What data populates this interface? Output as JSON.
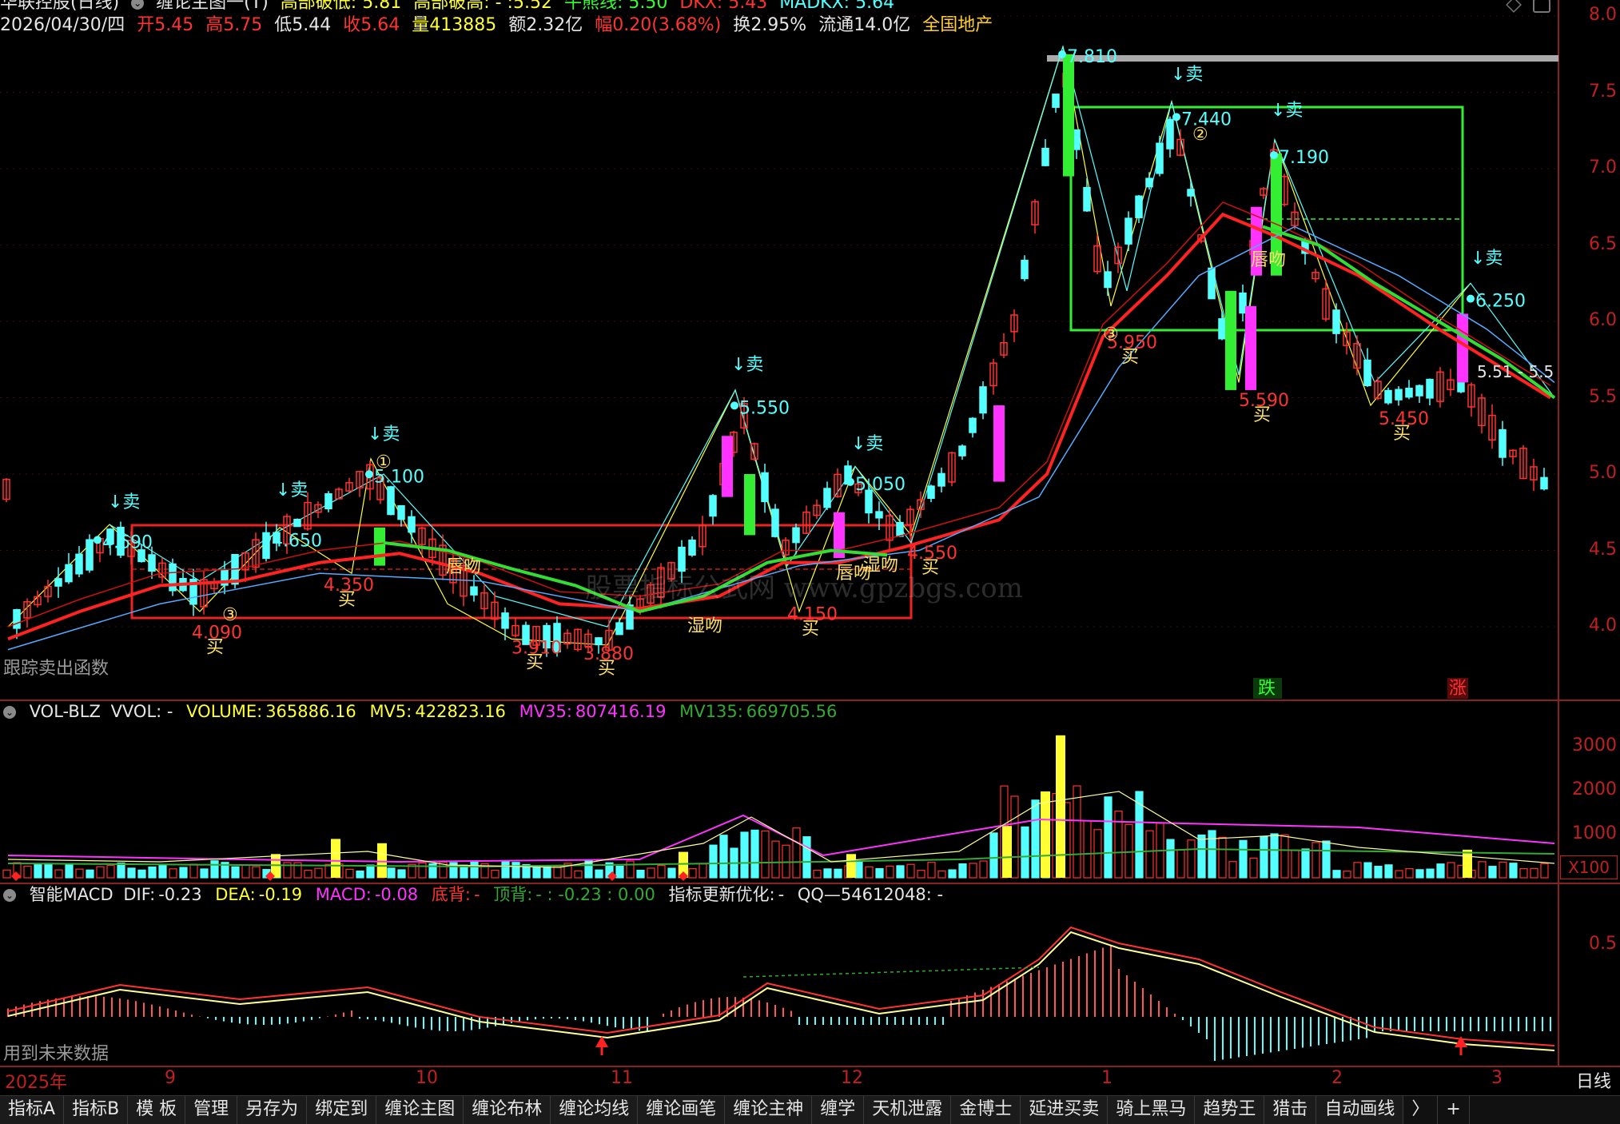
{
  "header": {
    "line1": {
      "stock": "华联控股(日线)",
      "indicator_main": "缠论主图一(T)",
      "ds_label": "高部破低:",
      "ds_value": "5.81",
      "gb_label": "高部破高:",
      "gb_value": "- :5.52",
      "nx_label": "牛熊线:",
      "nx_value": "5.50",
      "dkx_label": "DKX:",
      "dkx_value": "5.43",
      "madkx_label": "MADKX:",
      "madkx_value": "5.64"
    },
    "line2": {
      "date": "2026/04/30/四",
      "open_label": "开",
      "open": "5.45",
      "high_label": "高",
      "high": "5.75",
      "low_label": "低",
      "low": "5.44",
      "close_label": "收",
      "close": "5.64",
      "vol_label": "量",
      "vol": "413885",
      "amt_label": "额",
      "amt": "2.32亿",
      "chg_label": "幅",
      "chg": "0.20(3.68%)",
      "turn_label": "换",
      "turn": "2.95%",
      "float_label": "流通",
      "float": "14.0亿",
      "sector": "全国地产"
    }
  },
  "main_chart": {
    "y_ticks": [
      "8.0",
      "7.5",
      "7.0",
      "6.5",
      "6.0",
      "5.5",
      "5.0",
      "4.5",
      "4.0"
    ],
    "annotations": {
      "sell": "↓卖",
      "buy": "买",
      "lip_kiss": "唇吻",
      "wet_kiss": "湿吻",
      "big_drop": "跌",
      "big_rise": "涨",
      "price_labels": [
        "4.690",
        "4.650",
        "5.100",
        "5.550",
        "5.050",
        "7.810",
        "7.440",
        "7.190",
        "6.250",
        "4.350",
        "4.090",
        "3.910",
        "3.880",
        "4.150",
        "4.550",
        "5.950",
        "5.590",
        "5.450"
      ],
      "circle_1": "①",
      "circle_2": "②",
      "circle_3": "③",
      "right_readout": "5.51 - 5.5",
      "bottom_left": "跟踪卖出函数",
      "watermark": "股票指标公式网 www.gpzbgs.com"
    }
  },
  "vol_panel": {
    "name": "VOL-BLZ",
    "vvol": "VVOL: -",
    "volume_label": "VOLUME:",
    "volume": "365886.16",
    "mv5_label": "MV5:",
    "mv5": "422823.16",
    "mv35_label": "MV35:",
    "mv35": "807416.19",
    "mv135_label": "MV135:",
    "mv135": "669705.56",
    "y_ticks": [
      "3000",
      "2000",
      "1000"
    ],
    "unit": "X100"
  },
  "macd_panel": {
    "name": "智能MACD",
    "dif_label": "DIF:",
    "dif": "-0.23",
    "dea_label": "DEA:",
    "dea": "-0.19",
    "macd_label": "MACD:",
    "macd": "-0.08",
    "bottom_div_label": "底背:",
    "bottom_div": "-",
    "top_div_label": "顶背:",
    "top_div": "- : -0.23 : 0.00",
    "update_label": "指标更新优化:",
    "update": "-",
    "qq": "QQ—54612048: -",
    "y_tick": "0.5",
    "footer": "用到未来数据"
  },
  "date_axis": {
    "labels": [
      "2025年",
      "9",
      "10",
      "11",
      "12",
      "1",
      "2",
      "3"
    ],
    "period": "日线"
  },
  "tabs": [
    "指标A",
    "指标B",
    "模 板",
    "管理",
    "另存为",
    "绑定到",
    "缠论主图",
    "缠论布林",
    "缠论均线",
    "缠论画笔",
    "缠论主神",
    "缠学",
    "天机泄露",
    "金博士",
    "延进买卖",
    "骑上黑马",
    "趋势王",
    "猎击",
    "自动画线",
    "〉",
    "+"
  ],
  "colors": {
    "background": "#000000",
    "axis_red": "#c02020",
    "up_red": "#ff3030",
    "down_cyan": "#54ffff",
    "green_box": "#33ee33",
    "red_box": "#ee2222",
    "yellow": "#ffff33",
    "magenta": "#ff33ff",
    "ma_green": "#33dd33",
    "ma_red": "#ff2222",
    "ma_blue": "#55aaff"
  }
}
